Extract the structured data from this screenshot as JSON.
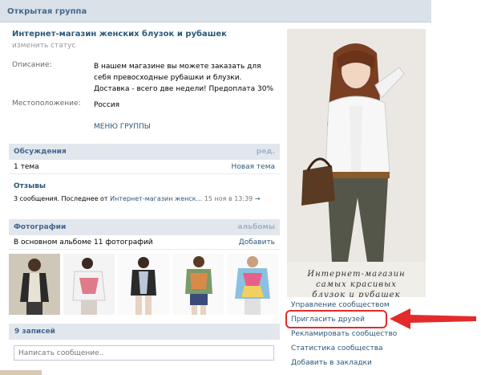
{
  "header": {
    "title": "Открытая группа"
  },
  "group": {
    "name": "Интернет-магазин женских блузок и рубашек",
    "status_link": "изменить статус",
    "info": [
      {
        "label": "Описание:",
        "value": "В нашем магазине вы можете заказать для себя превосходные рубашки и блузки. Доставка - всего две недели! Предоплата 30%"
      },
      {
        "label": "Местоположение:",
        "value": "Россия"
      }
    ],
    "menu_link": "МЕНЮ ГРУППЫ"
  },
  "discussions": {
    "title": "Обсуждения",
    "action": "ред.",
    "count": "1 тема",
    "new_topic": "Новая тема"
  },
  "reviews": {
    "title": "Отзывы",
    "meta": "3 сообщения. Последнее от",
    "author": "Интернет-магазин женск...",
    "date": "15 ноя в 13:39",
    "arrow": "→"
  },
  "photos": {
    "title": "Фотографии",
    "action": "альбомы",
    "album_info": "В основном альбоме 11 фотографий",
    "add_link": "Добавить"
  },
  "wall": {
    "title": "9 записей",
    "input_placeholder": "Написать сообщение.."
  },
  "avatar": {
    "caption_lines": [
      "Интернет-магазин",
      "самых красивых",
      "блузок и рубашек"
    ]
  },
  "actions": [
    "Управление сообществом",
    "Пригласить друзей",
    "Рекламировать сообщество",
    "Статистика сообщества",
    "Добавить в закладки"
  ],
  "colors": {
    "link": "#2b587a",
    "header_bg": "#dae1e8",
    "section_bg": "#e1e7ed",
    "highlight": "#e32b2b"
  }
}
